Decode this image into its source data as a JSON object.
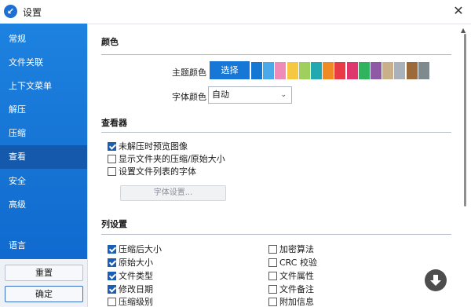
{
  "window": {
    "title": "设置",
    "close_glyph": "✕"
  },
  "sidebar": {
    "items": [
      {
        "label": "常规"
      },
      {
        "label": "文件关联"
      },
      {
        "label": "上下文菜单"
      },
      {
        "label": "解压"
      },
      {
        "label": "压缩"
      },
      {
        "label": "查看",
        "active": true
      },
      {
        "label": "安全"
      },
      {
        "label": "高级"
      },
      {
        "label": "语言"
      }
    ],
    "reset_label": "重置",
    "ok_label": "确定"
  },
  "color_section": {
    "title": "颜色",
    "theme_label": "主题颜色",
    "pick_label": "选择",
    "swatches": [
      "#1577d4",
      "#4aa9e8",
      "#f08ab7",
      "#f5c842",
      "#9fcf5c",
      "#21a8b0",
      "#f08a22",
      "#e83b45",
      "#e0366e",
      "#2fb35c",
      "#8d5aa3",
      "#c9b08a",
      "#a9b2ba",
      "#9c6a3a",
      "#7f8a8f"
    ],
    "font_label": "字体颜色",
    "font_value": "自动"
  },
  "viewer_section": {
    "title": "查看器",
    "options": [
      {
        "label": "未解压时预览图像",
        "checked": true
      },
      {
        "label": "显示文件夹的压缩/原始大小",
        "checked": false
      },
      {
        "label": "设置文件列表的字体",
        "checked": false
      }
    ],
    "font_settings_label": "字体设置..."
  },
  "columns_section": {
    "title": "列设置",
    "left": [
      {
        "label": "压缩后大小",
        "checked": true
      },
      {
        "label": "原始大小",
        "checked": true
      },
      {
        "label": "文件类型",
        "checked": true
      },
      {
        "label": "修改日期",
        "checked": true
      },
      {
        "label": "压缩级别",
        "checked": false
      }
    ],
    "right": [
      {
        "label": "加密算法",
        "checked": false
      },
      {
        "label": "CRC 校验",
        "checked": false
      },
      {
        "label": "文件属性",
        "checked": false
      },
      {
        "label": "文件备注",
        "checked": false
      },
      {
        "label": "附加信息",
        "checked": false
      }
    ]
  },
  "icons": {
    "app": "bandizip-icon",
    "close": "close-icon",
    "scroll_down": "arrow-down-circle-icon"
  }
}
